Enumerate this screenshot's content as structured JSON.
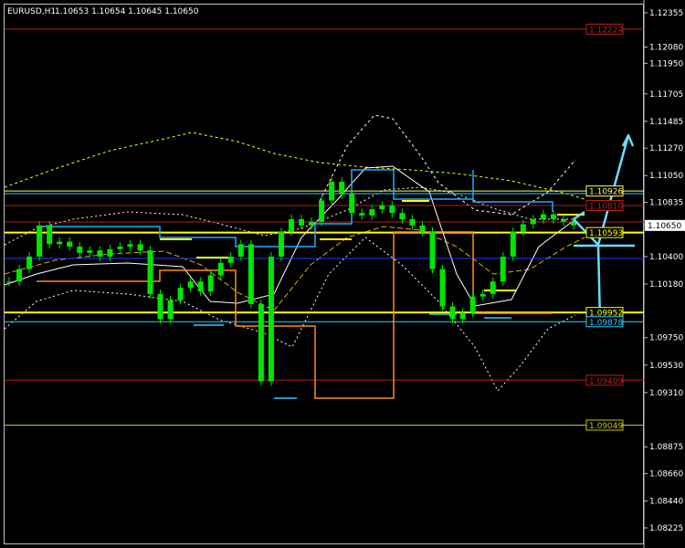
{
  "header": {
    "symbol": "EURUSD,H1",
    "ohlc": "1.10653 1.10654 1.10645 1.10650"
  },
  "colors": {
    "background": "#000000",
    "frame": "#c0c0c0",
    "candles": "#00e600",
    "resistance_red": "#b22222",
    "level_yellow": "#ffff00",
    "level_lightyellow": "#ffff66",
    "level_cyan": "#33ccff",
    "level_blue": "#1e3cff",
    "level_olive": "#c8c800",
    "step_orange": "#ff8c1a",
    "step_cyan": "#22aaff",
    "bands_white": "#ffffff",
    "ma_gold": "#e0b000",
    "arrow_cyan": "#66ddff"
  },
  "chart_data": {
    "type": "line",
    "title": "EURUSD,H1",
    "ylim": [
      1.0821,
      1.1242
    ],
    "price_axis_ticks": [
      "1.12355",
      "1.12080",
      "1.11950",
      "1.11705",
      "1.11485",
      "1.11270",
      "1.11050",
      "1.10835",
      "1.10400",
      "1.10180",
      "1.09750",
      "1.09530",
      "1.09310",
      "1.08875",
      "1.08660",
      "1.08440",
      "1.08225"
    ],
    "current_price": "1.10650",
    "horizontal_levels": [
      {
        "label": "1.12224",
        "value": 1.12224,
        "color": "#b22222"
      },
      {
        "label": "1.10926",
        "value": 1.10926,
        "color": "#ffff66"
      },
      {
        "label": "1.10810",
        "value": 1.1081,
        "color": "#b22222"
      },
      {
        "label": "1.10593",
        "value": 1.10593,
        "color": "#ffff00"
      },
      {
        "label": "1.09952",
        "value": 1.09952,
        "color": "#ffff00"
      },
      {
        "label": "1.09878",
        "value": 1.09878,
        "color": "#33ccff"
      },
      {
        "label": "1.09409",
        "value": 1.09409,
        "color": "#b22222"
      },
      {
        "label": "1.09049",
        "value": 1.09049,
        "color": "#c8c800"
      }
    ],
    "price_series": [
      1.102,
      1.103,
      1.104,
      1.1065,
      1.105,
      1.1052,
      1.1048,
      1.1043,
      1.1045,
      1.104,
      1.1046,
      1.1048,
      1.105,
      1.1045,
      1.101,
      1.099,
      1.1005,
      1.1015,
      1.102,
      1.1012,
      1.1025,
      1.1035,
      1.104,
      1.105,
      1.1002,
      1.094,
      1.104,
      1.106,
      1.107,
      1.1065,
      1.1068,
      1.1085,
      1.11,
      1.109,
      1.1075,
      1.1073,
      1.1078,
      1.1081,
      1.1075,
      1.107,
      1.1065,
      1.106,
      1.103,
      1.1,
      1.099,
      1.0995,
      1.1008,
      1.101,
      1.102,
      1.104,
      1.106,
      1.1066,
      1.107,
      1.1074,
      1.107,
      1.1068,
      1.1065
    ]
  }
}
